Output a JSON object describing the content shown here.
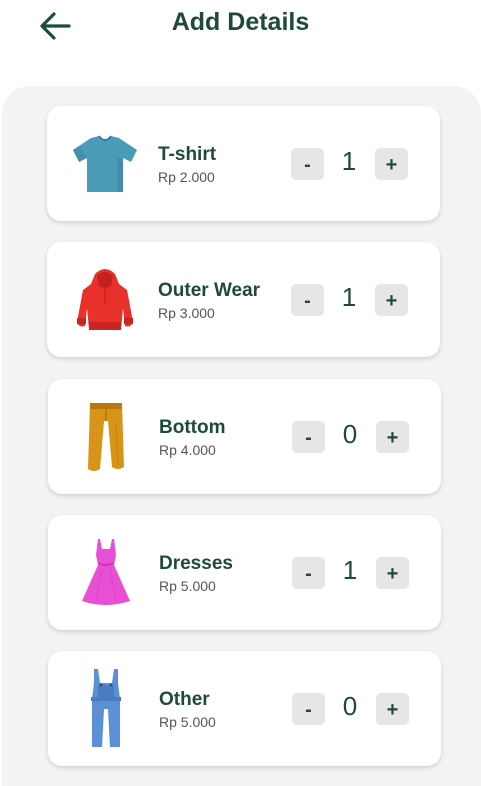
{
  "header": {
    "title": "Add Details",
    "back_icon": "arrow-left-icon"
  },
  "items": [
    {
      "name": "T-shirt",
      "price": "Rp 2.000",
      "quantity": "1",
      "icon": "tshirt-icon",
      "minus_label": "-",
      "plus_label": "+"
    },
    {
      "name": "Outer Wear",
      "price": "Rp 3.000",
      "quantity": "1",
      "icon": "hoodie-icon",
      "minus_label": "-",
      "plus_label": "+"
    },
    {
      "name": "Bottom",
      "price": "Rp 4.000",
      "quantity": "0",
      "icon": "pants-icon",
      "minus_label": "-",
      "plus_label": "+"
    },
    {
      "name": "Dresses",
      "price": "Rp 5.000",
      "quantity": "1",
      "icon": "dress-icon",
      "minus_label": "-",
      "plus_label": "+"
    },
    {
      "name": "Other",
      "price": "Rp 5.000",
      "quantity": "0",
      "icon": "overalls-icon",
      "minus_label": "-",
      "plus_label": "+"
    }
  ],
  "colors": {
    "title_text": "#1e4a3a",
    "panel_bg": "#f3f3f3",
    "button_bg": "#e6e6e6",
    "tshirt": "#4a9bb8",
    "hoodie": "#e8312a",
    "pants": "#d89418",
    "dress": "#e84fd4",
    "overalls": "#5b8fd6"
  }
}
